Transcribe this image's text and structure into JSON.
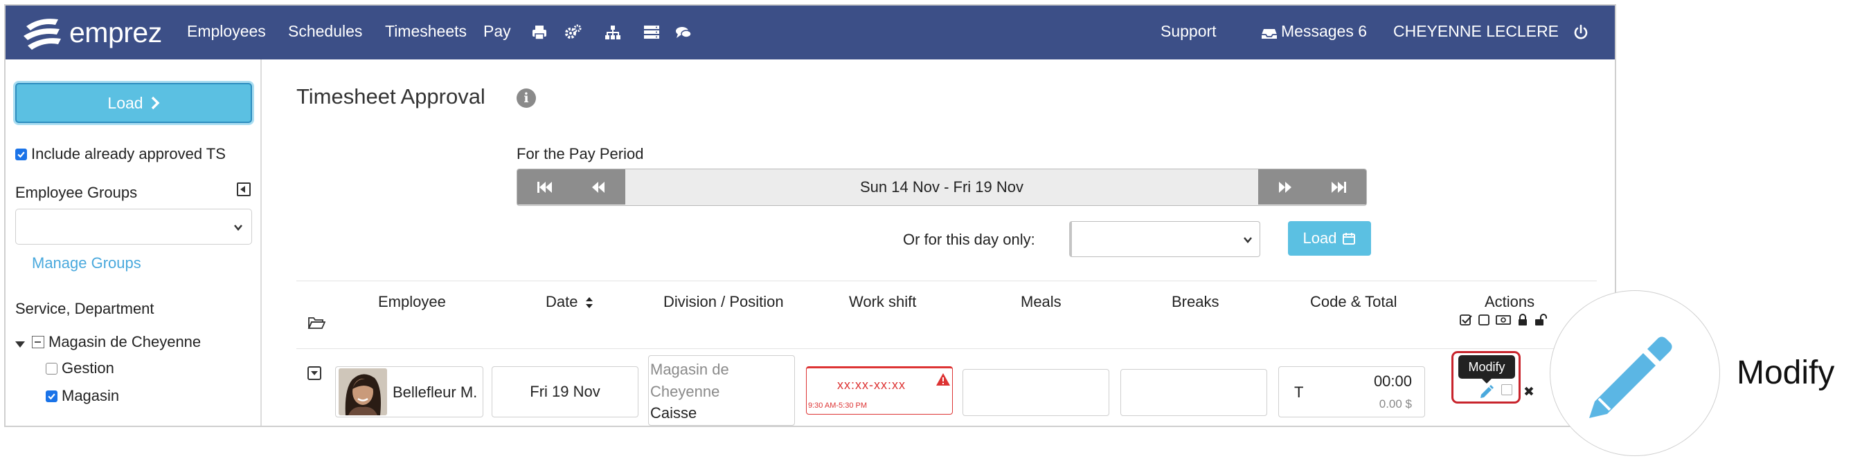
{
  "nav": {
    "brand": "emprez",
    "links": [
      "Employees",
      "Schedules",
      "Timesheets",
      "Pay"
    ],
    "icons": [
      "printer-icon",
      "cogs-icon",
      "sitemap-icon",
      "server-icon",
      "comments-icon"
    ],
    "support": "Support",
    "messages": "Messages 6",
    "user": "CHEYENNE LECLERE",
    "power_icon": "power-icon"
  },
  "sidebar": {
    "load_label": "Load",
    "include_approved": "Include already approved TS",
    "include_approved_checked": true,
    "employee_groups_label": "Employee Groups",
    "employee_groups_value": "",
    "manage_groups": "Manage Groups",
    "service_label": "Service, Department",
    "tree": {
      "root": "Magasin de Cheyenne",
      "children": [
        {
          "label": "Gestion",
          "checked": false
        },
        {
          "label": "Magasin",
          "checked": true
        }
      ]
    }
  },
  "main": {
    "title": "Timesheet Approval",
    "pay_period_label": "For the Pay Period",
    "pay_period_range": "Sun 14 Nov - Fri 19 Nov",
    "day_only_label": "Or for this day only:",
    "day_only_value": "",
    "load_label": "Load",
    "columns": [
      "Employee",
      "Date",
      "Division / Position",
      "Work shift",
      "Meals",
      "Breaks",
      "Code & Total",
      "Actions"
    ],
    "rows": [
      {
        "employee": "Bellefleur M.",
        "date": "Fri 19 Nov",
        "division": "Magasin de Cheyenne",
        "division_line1": "Magasin de",
        "division_line2": "Cheyenne",
        "position": "Caisse",
        "shift": "xx:xx-xx:xx",
        "shift_scheduled": "9:30 AM-5:30 PM",
        "meals": "",
        "breaks": "",
        "code": "T",
        "total_time": "00:00",
        "total_amount": "0.00 $"
      }
    ],
    "tooltip": "Modify"
  },
  "callout": {
    "label": "Modify",
    "icon": "pencil-icon"
  },
  "colors": {
    "navbar": "#3c4f87",
    "accent": "#5bc0e2",
    "link": "#4aa9dd",
    "error": "#d33333",
    "highlight_box": "#c8242c"
  }
}
